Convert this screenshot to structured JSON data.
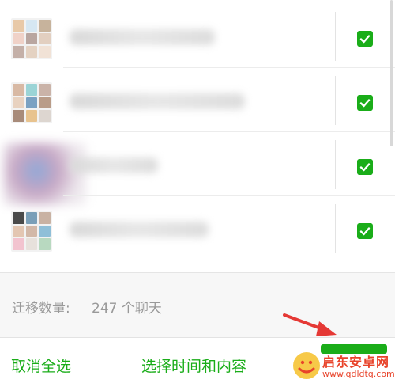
{
  "chat_list": {
    "rows": [
      {
        "selected": true
      },
      {
        "selected": true
      },
      {
        "selected": true
      },
      {
        "selected": true
      }
    ]
  },
  "migration": {
    "label": "迁移数量:",
    "value": "247 个聊天"
  },
  "bottom_bar": {
    "cancel_all": "取消全选",
    "select_time_content": "选择时间和内容"
  },
  "watermark": {
    "title": "启东安卓网",
    "url": "www.qdldtq.com"
  },
  "colors": {
    "accent": "#1aad19",
    "muted_text": "#999999",
    "arrow": "#e53935",
    "watermark": "#e8432a"
  },
  "icons": [
    "checkbox-checked-icon",
    "red-arrow-icon",
    "watermark-logo-icon"
  ]
}
